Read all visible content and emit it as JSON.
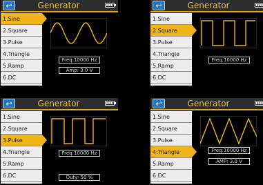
{
  "screens": [
    {
      "title": "Generator",
      "active": 0,
      "items": [
        "1.Sine",
        "2.Square",
        "3.Pulse",
        "4.Triangle",
        "5.Ramp",
        "6.DC"
      ],
      "freq": "Freq:10000 Hz",
      "extra": "Amp: 3.0  V"
    },
    {
      "title": "Generator",
      "active": 1,
      "items": [
        "1.Sine",
        "2.Square",
        "3.Pulse",
        "4.Triangle",
        "5.Ramp",
        "6.DC"
      ],
      "freq": "Freq:10000 Hz"
    },
    {
      "title": "Generator",
      "active": 2,
      "items": [
        "1.Sine",
        "2.Square",
        "3.Pulse",
        "4.Triangle",
        "5.Ramp",
        "6.DC"
      ],
      "freq": "Freq:10000 Hz",
      "extra": "Duty:  50  %"
    },
    {
      "title": "Generator",
      "active": 3,
      "items": [
        "1.Sine",
        "2.Square",
        "3.Pulse",
        "4.Triangle",
        "5.Ramp",
        "6.DC"
      ],
      "freq": "Freq:10000 Hz",
      "extra": "AMP:  3.0   V"
    }
  ],
  "back_icon": "return-arrow-icon",
  "battery_icon": "battery-icon",
  "colors": {
    "accent": "#f1b51a",
    "title": "#f0c21c",
    "back": "#1f74c8",
    "menu": "#ededed"
  }
}
